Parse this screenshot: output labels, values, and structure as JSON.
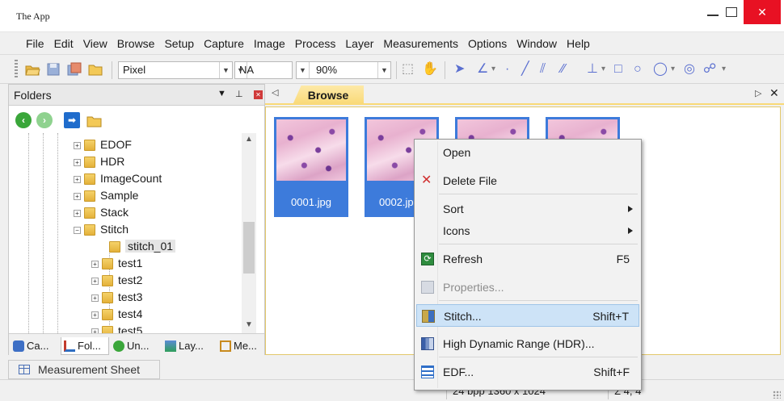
{
  "window": {
    "title": "The App"
  },
  "menu": [
    "File",
    "Edit",
    "View",
    "Browse",
    "Setup",
    "Capture",
    "Image",
    "Process",
    "Layer",
    "Measurements",
    "Options",
    "Window",
    "Help"
  ],
  "toolbar": {
    "unit_combo": "Pixel",
    "na_combo": "NA",
    "zoom_combo": "90%"
  },
  "folders_panel": {
    "title": "Folders",
    "tree": [
      {
        "label": "EDOF"
      },
      {
        "label": "HDR"
      },
      {
        "label": "ImageCount"
      },
      {
        "label": "Sample"
      },
      {
        "label": "Stack"
      },
      {
        "label": "Stitch"
      },
      {
        "label": "stitch_01"
      },
      {
        "label": "test1"
      },
      {
        "label": "test2"
      },
      {
        "label": "test3"
      },
      {
        "label": "test4"
      },
      {
        "label": "test5"
      }
    ],
    "tabs": [
      {
        "label": "Ca..."
      },
      {
        "label": "Fol..."
      },
      {
        "label": "Un..."
      },
      {
        "label": "Lay..."
      },
      {
        "label": "Me..."
      }
    ]
  },
  "measurement_sheet": {
    "label": "Measurement Sheet"
  },
  "browse": {
    "tab_label": "Browse",
    "thumbnails": [
      {
        "caption": "0001.jpg"
      },
      {
        "caption": "0002.jp"
      },
      {
        "caption": ""
      },
      {
        "caption": ""
      }
    ]
  },
  "context_menu": {
    "items": [
      {
        "label": "Open",
        "shortcut": ""
      },
      {
        "label": "Delete File",
        "shortcut": ""
      },
      {
        "label": "Sort",
        "shortcut": ""
      },
      {
        "label": "Icons",
        "shortcut": ""
      },
      {
        "label": "Refresh",
        "shortcut": "F5"
      },
      {
        "label": "Properties...",
        "shortcut": ""
      },
      {
        "label": "Stitch...",
        "shortcut": "Shift+T"
      },
      {
        "label": "High Dynamic Range (HDR)...",
        "shortcut": ""
      },
      {
        "label": "EDF...",
        "shortcut": "Shift+F"
      }
    ]
  },
  "status": {
    "image_info": "24 bpp  1360 x 1024",
    "sum_label": "Σ 4, 4"
  },
  "colors": {
    "close_red": "#e81123",
    "selection_blue": "#3d7bdb",
    "browse_tab_yellow": "#f9d976",
    "menu_hover": "#cde3f7"
  }
}
